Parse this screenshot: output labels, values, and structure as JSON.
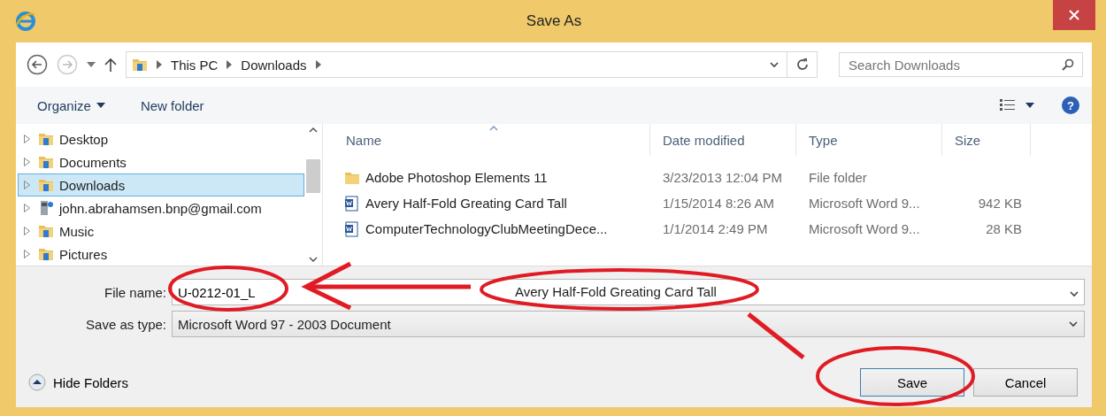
{
  "window": {
    "title": "Save As"
  },
  "address": {
    "segments": [
      "This PC",
      "Downloads"
    ]
  },
  "search": {
    "placeholder": "Search Downloads"
  },
  "toolbar": {
    "organize": "Organize",
    "new_folder": "New folder"
  },
  "tree": {
    "items": [
      {
        "label": "Desktop",
        "kind": "folder",
        "selected": false
      },
      {
        "label": "Documents",
        "kind": "folder",
        "selected": false
      },
      {
        "label": "Downloads",
        "kind": "folder",
        "selected": true
      },
      {
        "label": "john.abrahamsen.bnp@gmail.com",
        "kind": "account",
        "selected": false
      },
      {
        "label": "Music",
        "kind": "folder",
        "selected": false
      },
      {
        "label": "Pictures",
        "kind": "folder",
        "selected": false
      }
    ]
  },
  "table": {
    "columns": [
      "Name",
      "Date modified",
      "Type",
      "Size"
    ],
    "rows": [
      {
        "kind": "folder",
        "name": "Adobe Photoshop Elements 11",
        "date": "3/23/2013 12:04 PM",
        "type": "File folder"
      },
      {
        "kind": "document",
        "name": "Avery Half-Fold Greating Card Tall",
        "date": "1/15/2014 8:26 AM",
        "type": "Microsoft Word 9...",
        "size": "942 KB"
      },
      {
        "kind": "document",
        "name": "ComputerTechnologyClubMeetingDece...",
        "date": "1/1/2014 2:49 PM",
        "type": "Microsoft Word 9...",
        "size": "28 KB"
      }
    ]
  },
  "file_name": {
    "label": "File name:",
    "value": "U-0212-01_L"
  },
  "save_as_type": {
    "label": "Save as type:",
    "value": "Microsoft Word 97 - 2003 Document"
  },
  "annotation": {
    "text": "Avery Half-Fold Greating Card Tall"
  },
  "hide_folders": "Hide Folders",
  "help": "?",
  "buttons": [
    "Save",
    "Cancel"
  ]
}
